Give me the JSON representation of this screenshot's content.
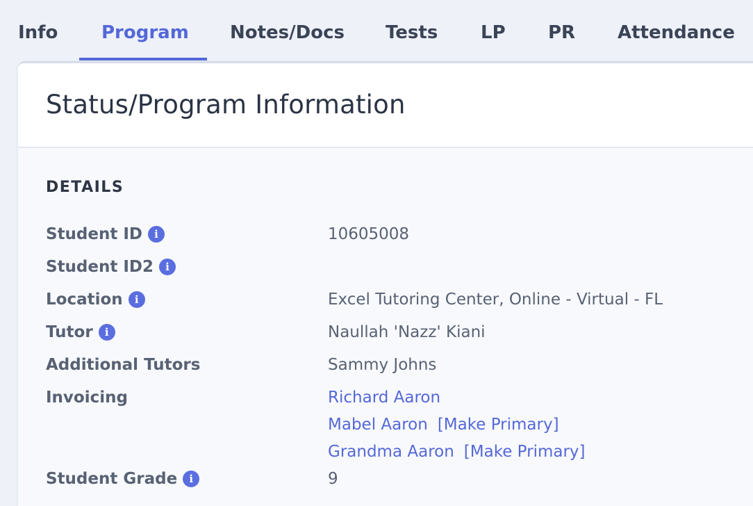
{
  "tabs": [
    {
      "label": "Info"
    },
    {
      "label": "Program"
    },
    {
      "label": "Notes/Docs"
    },
    {
      "label": "Tests"
    },
    {
      "label": "LP"
    },
    {
      "label": "PR"
    },
    {
      "label": "Attendance"
    }
  ],
  "active_tab": "Program",
  "card": {
    "title": "Status/Program Information",
    "section": "DETAILS"
  },
  "details": {
    "student_id": {
      "label": "Student ID",
      "value": "10605008"
    },
    "student_id2": {
      "label": "Student ID2",
      "value": ""
    },
    "location": {
      "label": "Location",
      "value": "Excel Tutoring Center, Online - Virtual - FL"
    },
    "tutor": {
      "label": "Tutor",
      "value": "Naullah 'Nazz' Kiani"
    },
    "additional_tutors": {
      "label": "Additional Tutors",
      "value": "Sammy Johns"
    },
    "invoicing": {
      "label": "Invoicing",
      "contacts": [
        {
          "name": "Richard Aaron",
          "action": ""
        },
        {
          "name": "Mabel Aaron",
          "action": "[Make Primary]"
        },
        {
          "name": "Grandma Aaron",
          "action": "[Make Primary]"
        }
      ]
    },
    "student_grade": {
      "label": "Student Grade",
      "value": "9"
    }
  },
  "icons": {
    "info": "info-icon"
  },
  "colors": {
    "accent": "#5468d8",
    "text": "#586274",
    "heading": "#2b3445",
    "info_icon": "#5a6ee0"
  }
}
